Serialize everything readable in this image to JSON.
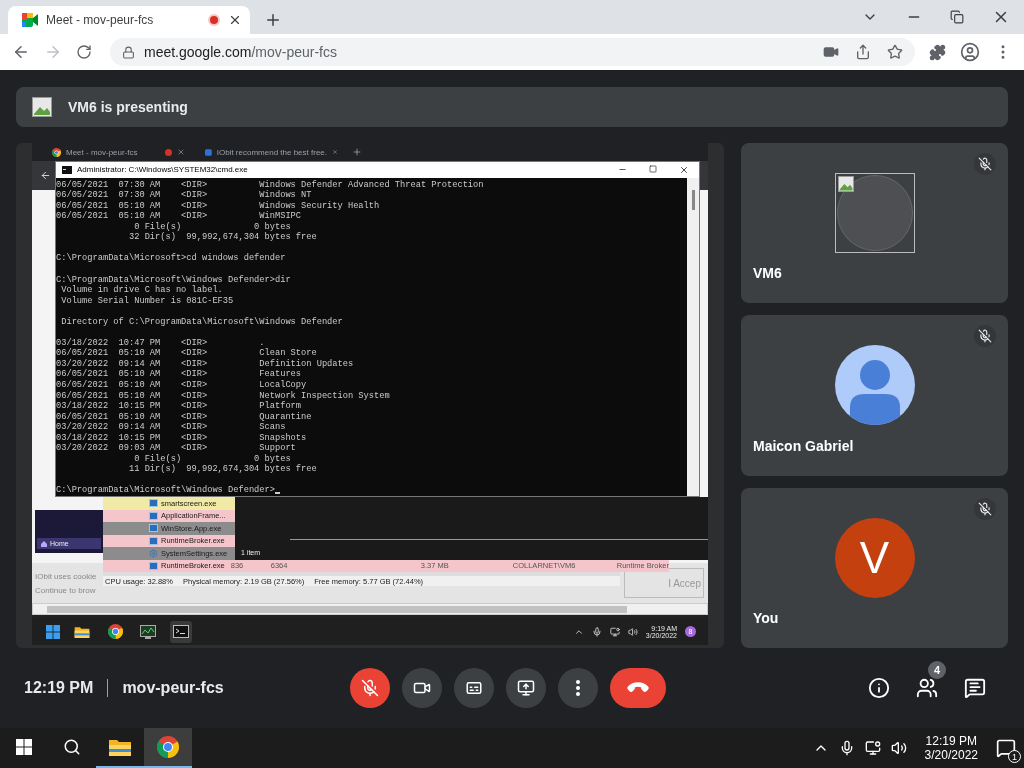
{
  "browser": {
    "tab": {
      "title": "Meet - mov-peur-fcs",
      "recording": true
    },
    "url_host": "meet.google.com",
    "url_path": "/mov-peur-fcs"
  },
  "presenting": {
    "label": "VM6 is presenting"
  },
  "shared_screen": {
    "remote_tabs": [
      {
        "title": "Meet - mov-peur-fcs",
        "recording": true
      },
      {
        "title": "IObit recommend the best free.",
        "recording": false
      }
    ],
    "console": {
      "title": "Administrator: C:\\Windows\\SYSTEM32\\cmd.exe",
      "blocks": [
        [
          "06/05/2021  07:30 AM    <DIR>          Windows Defender Advanced Threat Protection",
          "06/05/2021  07:30 AM    <DIR>          Windows NT",
          "06/05/2021  05:10 AM    <DIR>          Windows Security Health",
          "06/05/2021  05:10 AM    <DIR>          WinMSIPC",
          "               0 File(s)              0 bytes",
          "              32 Dir(s)  99,992,674,304 bytes free"
        ],
        [
          "C:\\ProgramData\\Microsoft>cd windows defender"
        ],
        [
          "C:\\ProgramData\\Microsoft\\Windows Defender>dir",
          " Volume in drive C has no label.",
          " Volume Serial Number is 081C-EF35"
        ],
        [
          " Directory of C:\\ProgramData\\Microsoft\\Windows Defender"
        ],
        [
          "03/18/2022  10:47 PM    <DIR>          .",
          "06/05/2021  05:10 AM    <DIR>          Clean Store",
          "03/20/2022  09:14 AM    <DIR>          Definition Updates",
          "06/05/2021  05:10 AM    <DIR>          Features",
          "06/05/2021  05:10 AM    <DIR>          LocalCopy",
          "06/05/2021  05:10 AM    <DIR>          Network Inspection System",
          "03/18/2022  10:15 PM    <DIR>          Platform",
          "06/05/2021  05:10 AM    <DIR>          Quarantine",
          "03/20/2022  09:14 AM    <DIR>          Scans",
          "03/18/2022  10:15 PM    <DIR>          Snapshots",
          "03/20/2022  09:03 AM    <DIR>          Support",
          "               0 File(s)              0 bytes",
          "              11 Dir(s)  99,992,674,304 bytes free"
        ]
      ],
      "prompt": "C:\\ProgramData\\Microsoft\\Windows Defender>"
    },
    "app_panel": {
      "item": "Home"
    },
    "cookie_banner": {
      "lines": [
        "IObit uses cookie",
        "Continue to brow"
      ],
      "button": "I Accep"
    },
    "task_manager": {
      "processes": [
        {
          "name": "smartscreen.exe",
          "kind": "app",
          "color": "#f1e9a6"
        },
        {
          "name": "ApplicationFrame...",
          "kind": "app",
          "color": "#f5c5cc"
        },
        {
          "name": "WinStore.App.exe",
          "kind": "app",
          "color": "#8c8c8c"
        },
        {
          "name": "RuntimeBroker.exe",
          "kind": "app",
          "color": "#f5c5cc"
        },
        {
          "name": "SystemSettings.exe",
          "kind": "settings",
          "color": "#8c8c8c"
        },
        {
          "name": "RuntimeBroker.exe",
          "kind": "app",
          "color": "#f5c5cc",
          "details": [
            "836",
            "6364",
            "3.37 MB",
            "COLLARNET\\VM6",
            "Runtime Broker"
          ]
        }
      ],
      "selection_count": "1 item",
      "status": [
        "CPU usage: 32.88%",
        "Physical memory: 2.19 GB (27.56%)",
        "Free memory: 5.77 GB (72.44%)"
      ]
    },
    "taskbar": {
      "apps": [
        {
          "kind": "explorer",
          "selected": false
        },
        {
          "kind": "chrome",
          "selected": false
        },
        {
          "kind": "monitor",
          "selected": false
        },
        {
          "kind": "terminal",
          "selected": true
        }
      ],
      "time": "9:19 AM",
      "date": "3/20/2022",
      "badge": "8"
    }
  },
  "participants": [
    {
      "name": "VM6",
      "muted": true,
      "kind": "image"
    },
    {
      "name": "Maicon Gabriel",
      "muted": true,
      "kind": "silhouette"
    },
    {
      "name": "You",
      "muted": true,
      "kind": "initial",
      "initial": "V"
    }
  ],
  "bottom_bar": {
    "time": "12:19 PM",
    "meeting_code": "mov-peur-fcs",
    "controls": [
      {
        "kind": "mic",
        "on": false
      },
      {
        "kind": "camera",
        "on": true
      },
      {
        "kind": "captions"
      },
      {
        "kind": "present"
      },
      {
        "kind": "more"
      },
      {
        "kind": "hangup"
      }
    ],
    "side": [
      {
        "kind": "info"
      },
      {
        "kind": "people",
        "badge": "4"
      },
      {
        "kind": "chat"
      }
    ]
  },
  "taskbar": {
    "apps": [
      {
        "kind": "explorer",
        "selected": false
      },
      {
        "kind": "chrome",
        "selected": true
      }
    ],
    "time": "12:19 PM",
    "date": "3/20/2022",
    "notifications": "1"
  }
}
